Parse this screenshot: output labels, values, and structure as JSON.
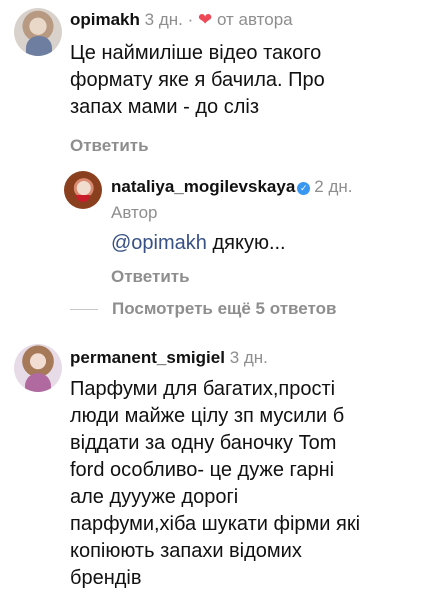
{
  "comments": [
    {
      "username": "opimakh",
      "age": "3 дн.",
      "liked_by_author_label": "от автора",
      "text_lines": [
        "Це наймиліше відео такого",
        "формату яке я бачила. Про",
        "запах мами - до сліз"
      ],
      "reply_label": "Ответить",
      "replies": [
        {
          "username": "nataliya_mogilevskaya",
          "verified": true,
          "age": "2 дн.",
          "role_label": "Автор",
          "mention": "@opimakh",
          "text": " дякую...",
          "reply_label": "Ответить"
        }
      ],
      "view_more_label": "Посмотреть ещё 5 ответов"
    },
    {
      "username": "permanent_smigiel",
      "age": "3 дн.",
      "text_lines": [
        "Парфуми для багатих,прості",
        "люди майже цілу зп мусили б",
        "віддати за одну баночку Tom",
        "ford особливо- це дуже гарні",
        "але дуууже дорогі",
        "парфуми,хіба шукати фірми які",
        "копіюють запахи відомих",
        "брендів"
      ]
    }
  ],
  "colors": {
    "heart": "#ed4956",
    "mention": "#385185",
    "verified": "#3897f0",
    "meta": "#8e8e8e"
  },
  "icons": {
    "heart": "heart-icon",
    "verified": "verified-badge-icon"
  }
}
